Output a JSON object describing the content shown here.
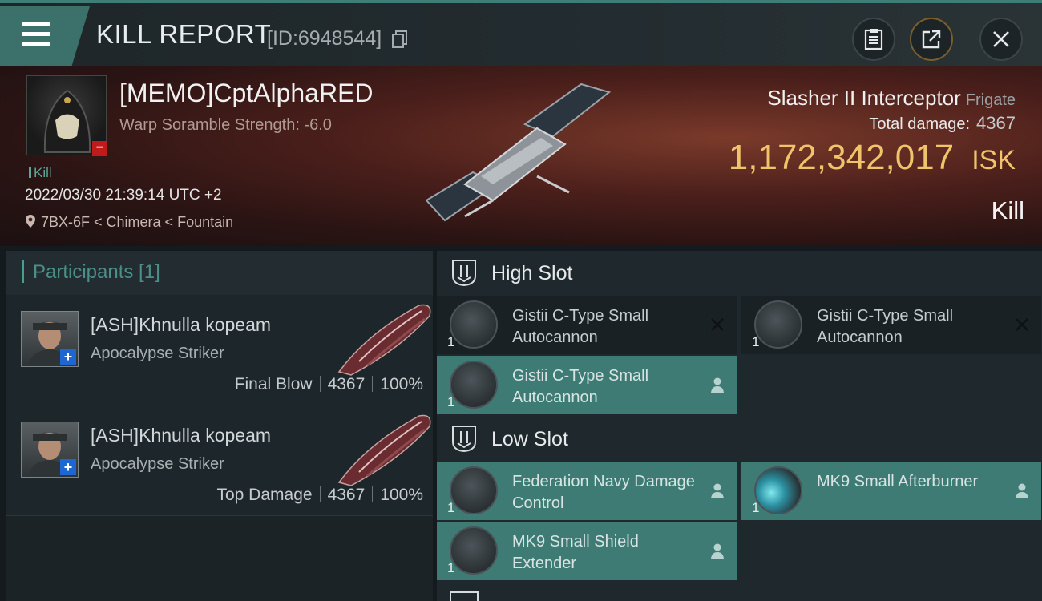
{
  "window": {
    "title": "KILL REPORT",
    "report_id": "[ID:6948544]",
    "buttons": [
      "clipboard-icon",
      "share-icon",
      "close-icon"
    ]
  },
  "victim": {
    "name": "[MEMO]CptAlphaRED",
    "warp_scramble": "Warp Soramble Strength: -6.0",
    "tag": "Kill",
    "datetime": "2022/03/30 21:39:14 UTC +2",
    "location": "7BX-6F < Chimera < Fountain",
    "ship_name": "Slasher II Interceptor",
    "ship_class": "Frigate",
    "total_damage_label": "Total damage:",
    "total_damage_value": "4367",
    "isk_value": "1,172,342,017",
    "isk_unit": "ISK",
    "result": "Kill"
  },
  "participants": {
    "label": "Participants [1]",
    "rows": [
      {
        "name": "[ASH]Khnulla kopeam",
        "ship": "Apocalypse Striker",
        "role": "Final Blow",
        "damage": "4367",
        "percent": "100%"
      },
      {
        "name": "[ASH]Khnulla kopeam",
        "ship": "Apocalypse Striker",
        "role": "Top Damage",
        "damage": "4367",
        "percent": "100%"
      }
    ]
  },
  "fitting": {
    "high_slot": {
      "label": "High Slot",
      "modules": [
        {
          "name": "Gistii C-Type Small Autocannon",
          "qty": "1",
          "state": "destroyed"
        },
        {
          "name": "Gistii C-Type Small Autocannon",
          "qty": "1",
          "state": "destroyed"
        },
        {
          "name": "Gistii C-Type Small Autocannon",
          "qty": "1",
          "state": "dropped"
        }
      ]
    },
    "low_slot": {
      "label": "Low Slot",
      "modules": [
        {
          "name": "Federation Navy Damage Control",
          "qty": "1",
          "state": "dropped"
        },
        {
          "name": "MK9 Small Afterburner",
          "qty": "1",
          "state": "dropped"
        },
        {
          "name": "MK9 Small Shield Extender",
          "qty": "1",
          "state": "dropped"
        }
      ]
    }
  },
  "colors": {
    "accent": "#3d7b74",
    "isk": "#efc46b",
    "kill_tag": "#5ca597"
  }
}
